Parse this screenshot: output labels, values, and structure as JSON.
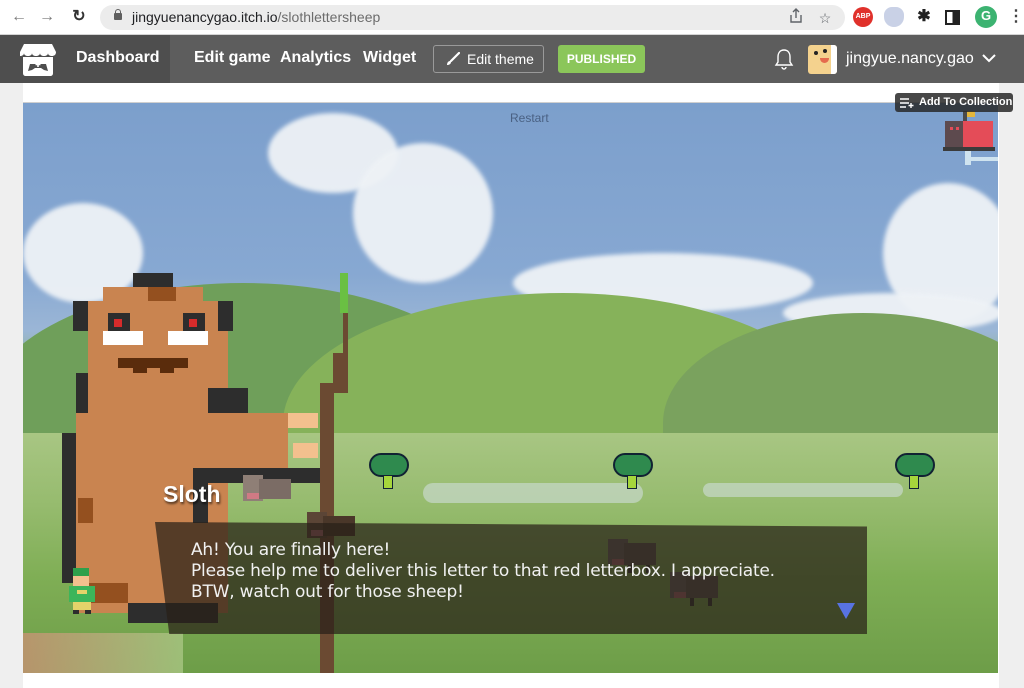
{
  "browser": {
    "url_host": "jingyuenancygao.itch.io",
    "url_path": "/slothlettersheep",
    "nav": {
      "back": "←",
      "forward": "→",
      "reload": "↻"
    },
    "extensions": [
      "ABP",
      "shield",
      "puzzle",
      "sidebar",
      "G"
    ]
  },
  "header": {
    "dashboard": "Dashboard",
    "links": [
      "Edit game",
      "Analytics",
      "Widget"
    ],
    "edit_theme": "Edit theme",
    "published": "PUBLISHED",
    "username": "jingyue.nancy.gao"
  },
  "game": {
    "restart": "Restart",
    "add_to_collection": "Add To Collection",
    "dialog": {
      "speaker": "Sloth",
      "lines": [
        "Ah! You are finally here!",
        "Please help me to deliver this letter to that red letterbox. I appreciate.",
        "BTW, watch out for those sheep!"
      ]
    }
  },
  "colors": {
    "itch_header": "#5d5d5d",
    "published_green": "#8bc65a",
    "dialog_arrow": "#5873e2"
  }
}
